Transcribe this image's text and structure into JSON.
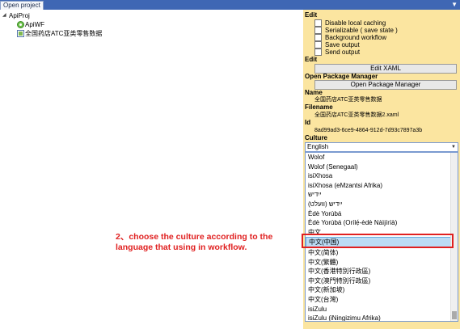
{
  "window": {
    "tab_label": "Open project"
  },
  "tree": {
    "root": "ApiProj",
    "children": [
      "ApiWF",
      "全国药店ATC亚类零售数据"
    ]
  },
  "panel": {
    "edit_header": "Edit",
    "checkboxes": [
      "Disable local caching",
      "Serializable ( save state )",
      "Background workflow",
      "Save output",
      "Send output"
    ],
    "edit_header_2": "Edit",
    "edit_xaml_button": "Edit XAML",
    "package_header": "Open Package Manager",
    "package_button": "Open Package Manager",
    "name_header": "Name",
    "name_value": "全国药店ATC亚类零售数据",
    "filename_header": "Filename",
    "filename_value": "全国药店ATC亚类零售数据2.xaml",
    "id_header": "Id",
    "id_value": "8ad99ad3-6ce9-4864-912d-7d93c7897a3b",
    "culture_header": "Culture",
    "culture_selected": "English"
  },
  "culture_list": [
    "Wolof",
    "Wolof (Senegaal)",
    "isiXhosa",
    "isiXhosa (eMzantsi Afrika)",
    "ייִדיש",
    "ייִדיש (וועלט)",
    "Èdè Yorùbá",
    "Èdè Yorùbá (Orílẹ́-èdè Nàìjíríà)",
    "中文",
    "中文(中国)",
    "中文(简体)",
    "中文(繁體)",
    "中文(香港特別行政區)",
    "中文(澳門特別行政區)",
    "中文(新加坡)",
    "中文(台灣)",
    "isiZulu",
    "isiZulu (iNingizimu Afrika)"
  ],
  "selected_index": 9,
  "annotation": "2、choose the culture according to the language that using in workflow."
}
